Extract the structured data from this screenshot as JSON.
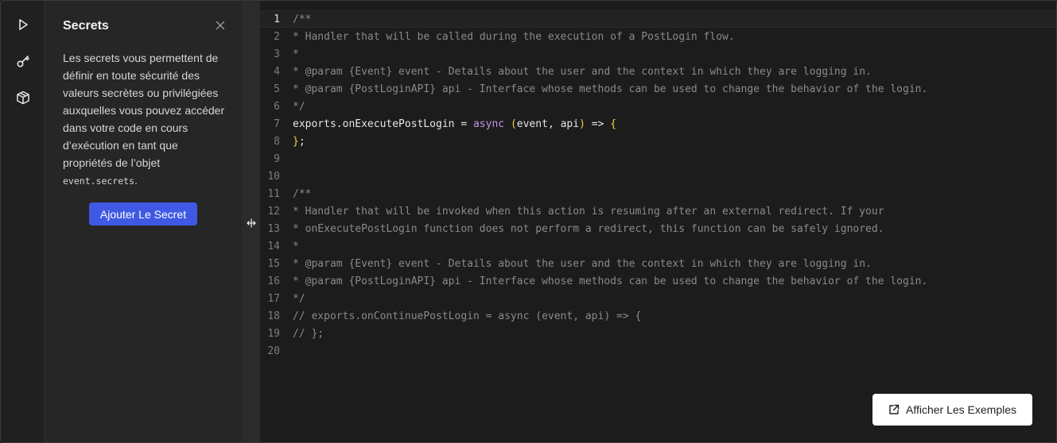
{
  "rail": {
    "icons": [
      "play-icon",
      "key-icon",
      "package-icon"
    ]
  },
  "secrets_panel": {
    "title": "Secrets",
    "description_before_code": "Les secrets vous permettent de définir en toute sécurité des valeurs secrètes ou privilégiées auxquelles vous pouvez accéder dans votre code en cours d’exécution en tant que propriétés de l’objet",
    "description_code": "event.secrets",
    "description_after_code": ".",
    "add_button_label": "Ajouter Le Secret"
  },
  "editor": {
    "active_line": 1,
    "lines": [
      {
        "n": "1",
        "tokens": [
          {
            "t": "/**",
            "c": "comment"
          }
        ]
      },
      {
        "n": "2",
        "tokens": [
          {
            "t": "* Handler that will be called during the execution of a PostLogin flow.",
            "c": "comment"
          }
        ]
      },
      {
        "n": "3",
        "tokens": [
          {
            "t": "*",
            "c": "comment"
          }
        ]
      },
      {
        "n": "4",
        "tokens": [
          {
            "t": "* @param {Event} event - Details about the user and the context in which they are logging in.",
            "c": "comment"
          }
        ]
      },
      {
        "n": "5",
        "tokens": [
          {
            "t": "* @param {PostLoginAPI} api - Interface whose methods can be used to change the behavior of the login.",
            "c": "comment"
          }
        ]
      },
      {
        "n": "6",
        "tokens": [
          {
            "t": "*/",
            "c": "comment"
          }
        ]
      },
      {
        "n": "7",
        "tokens": [
          {
            "t": "exports.onExecutePostLogin = ",
            "c": "plain"
          },
          {
            "t": "async",
            "c": "keyword"
          },
          {
            "t": " ",
            "c": "plain"
          },
          {
            "t": "(",
            "c": "paren"
          },
          {
            "t": "event, api",
            "c": "plain"
          },
          {
            "t": ")",
            "c": "paren"
          },
          {
            "t": " => ",
            "c": "plain"
          },
          {
            "t": "{",
            "c": "paren"
          }
        ]
      },
      {
        "n": "8",
        "tokens": [
          {
            "t": "}",
            "c": "paren"
          },
          {
            "t": ";",
            "c": "plain"
          }
        ]
      },
      {
        "n": "9",
        "tokens": []
      },
      {
        "n": "10",
        "tokens": []
      },
      {
        "n": "11",
        "tokens": [
          {
            "t": "/**",
            "c": "comment"
          }
        ]
      },
      {
        "n": "12",
        "tokens": [
          {
            "t": "* Handler that will be invoked when this action is resuming after an external redirect. If your",
            "c": "comment"
          }
        ]
      },
      {
        "n": "13",
        "tokens": [
          {
            "t": "* onExecutePostLogin function does not perform a redirect, this function can be safely ignored.",
            "c": "comment"
          }
        ]
      },
      {
        "n": "14",
        "tokens": [
          {
            "t": "*",
            "c": "comment"
          }
        ]
      },
      {
        "n": "15",
        "tokens": [
          {
            "t": "* @param {Event} event - Details about the user and the context in which they are logging in.",
            "c": "comment"
          }
        ]
      },
      {
        "n": "16",
        "tokens": [
          {
            "t": "* @param {PostLoginAPI} api - Interface whose methods can be used to change the behavior of the login.",
            "c": "comment"
          }
        ]
      },
      {
        "n": "17",
        "tokens": [
          {
            "t": "*/",
            "c": "comment"
          }
        ]
      },
      {
        "n": "18",
        "tokens": [
          {
            "t": "// exports.onContinuePostLogin = async (event, api) => {",
            "c": "comment"
          }
        ]
      },
      {
        "n": "19",
        "tokens": [
          {
            "t": "// };",
            "c": "comment"
          }
        ]
      },
      {
        "n": "20",
        "tokens": []
      }
    ]
  },
  "examples_button": {
    "label": "Afficher Les Exemples",
    "icon": "external-link-icon"
  },
  "colors": {
    "accent": "#3f59e4",
    "comment": "#8a8a8a",
    "keyword": "#c792ea",
    "paren": "#f5d142"
  }
}
